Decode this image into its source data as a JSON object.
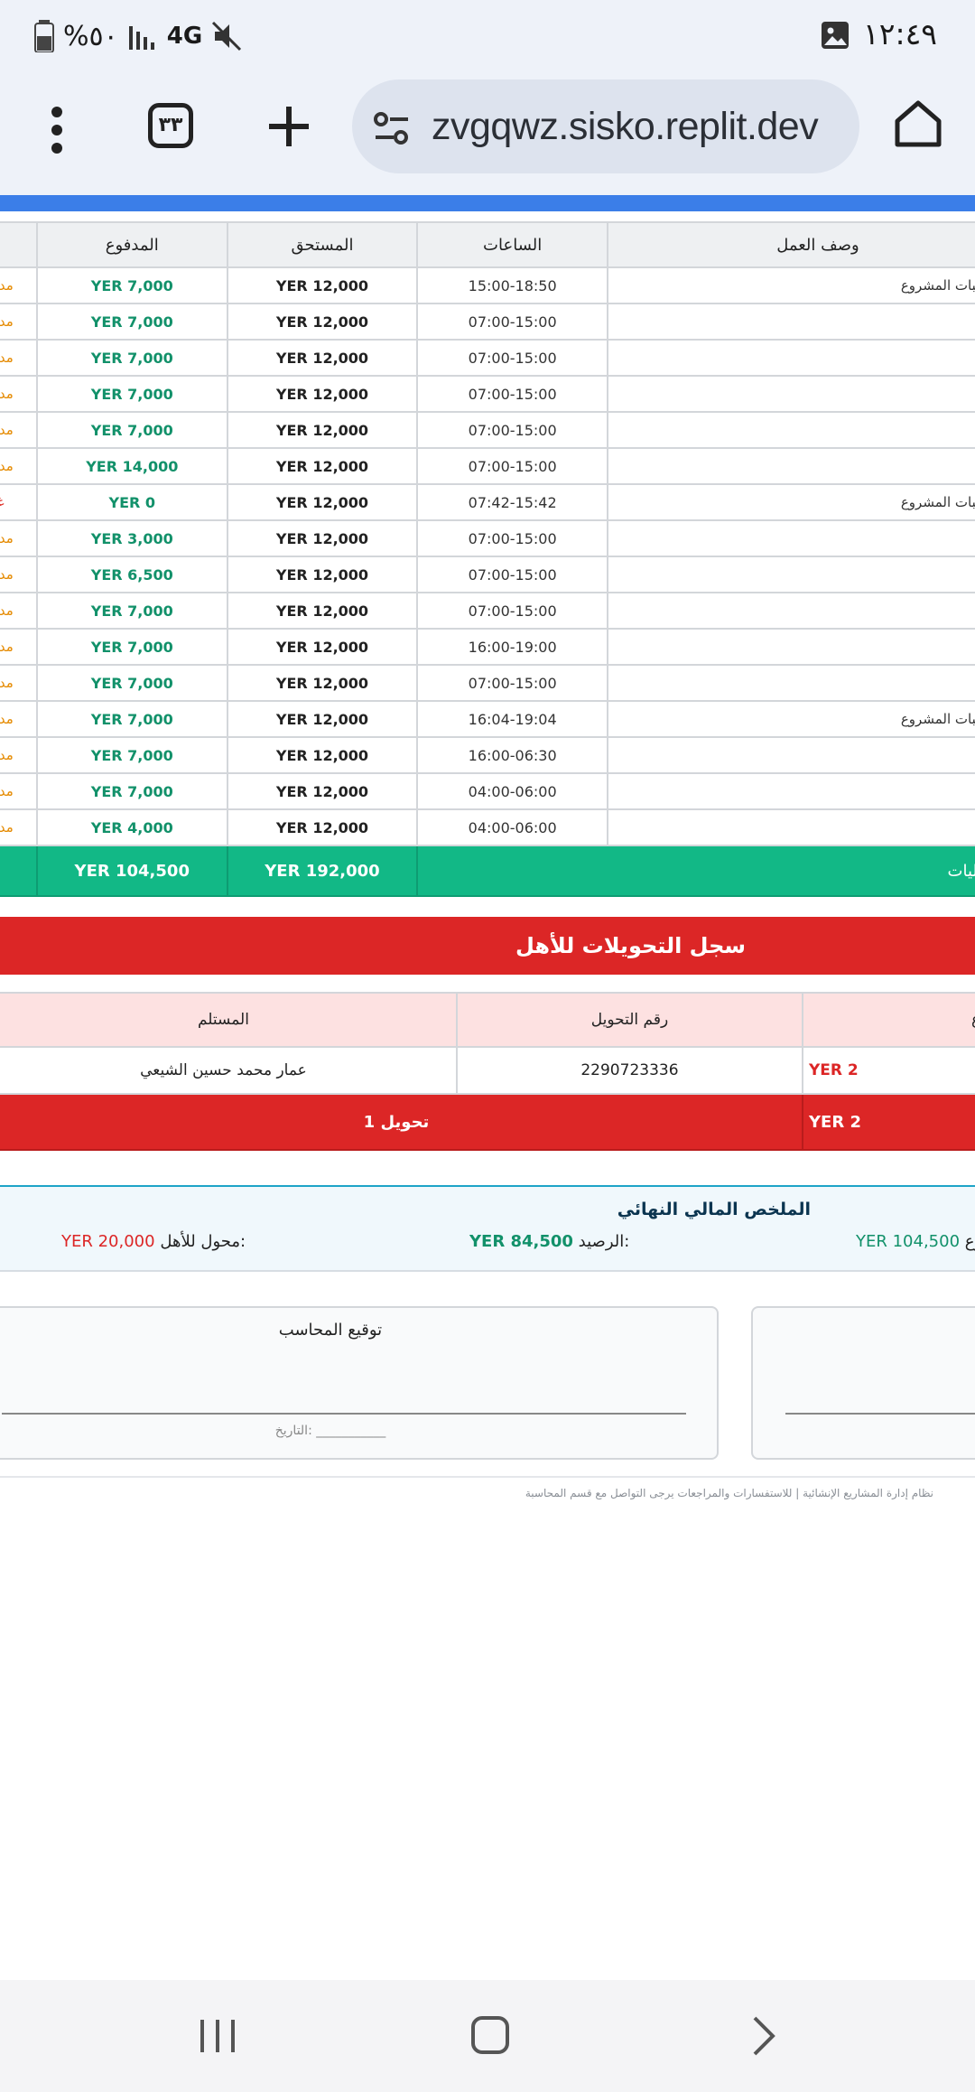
{
  "status_bar": {
    "time": "١٢:٤٩",
    "battery": "%٥٠",
    "network": "4G",
    "icons": [
      "gallery-icon",
      "mute-icon",
      "signal-icon",
      "battery-icon"
    ]
  },
  "browser": {
    "url": "zvgqwz.sisko.replit.dev",
    "tab_count": "٣٣",
    "icons": [
      "home-icon",
      "site-settings-icon",
      "new-tab-icon",
      "tab-switcher-icon",
      "menu-icon"
    ]
  },
  "work_table": {
    "headers": {
      "desc": "وصف العمل",
      "hours": "الساعات",
      "due": "المستحق",
      "paid": "المدفوع"
    },
    "rows": [
      {
        "desc": "طلبات المشروع",
        "hours": "15:00-18:50",
        "due": "YER 12,000",
        "paid": "YER 7,000",
        "status": "مدفو"
      },
      {
        "desc": "",
        "hours": "07:00-15:00",
        "due": "YER 12,000",
        "paid": "YER 7,000",
        "status": "مدفو"
      },
      {
        "desc": "",
        "hours": "07:00-15:00",
        "due": "YER 12,000",
        "paid": "YER 7,000",
        "status": "مدفو"
      },
      {
        "desc": "",
        "hours": "07:00-15:00",
        "due": "YER 12,000",
        "paid": "YER 7,000",
        "status": "مدفو"
      },
      {
        "desc": "",
        "hours": "07:00-15:00",
        "due": "YER 12,000",
        "paid": "YER 7,000",
        "status": "مدفو"
      },
      {
        "desc": "",
        "hours": "07:00-15:00",
        "due": "YER 12,000",
        "paid": "YER 14,000",
        "status": "مدفو"
      },
      {
        "desc": "طلبات المشروع",
        "hours": "07:42-15:42",
        "due": "YER 12,000",
        "paid": "YER 0",
        "status": "غير"
      },
      {
        "desc": "",
        "hours": "07:00-15:00",
        "due": "YER 12,000",
        "paid": "YER 3,000",
        "status": "مدفو"
      },
      {
        "desc": "",
        "hours": "07:00-15:00",
        "due": "YER 12,000",
        "paid": "YER 6,500",
        "status": "مدفو"
      },
      {
        "desc": "",
        "hours": "07:00-15:00",
        "due": "YER 12,000",
        "paid": "YER 7,000",
        "status": "مدفو"
      },
      {
        "desc": "",
        "hours": "16:00-19:00",
        "due": "YER 12,000",
        "paid": "YER 7,000",
        "status": "مدفو"
      },
      {
        "desc": "",
        "hours": "07:00-15:00",
        "due": "YER 12,000",
        "paid": "YER 7,000",
        "status": "مدفو"
      },
      {
        "desc": "طلبات المشروع",
        "hours": "16:04-19:04",
        "due": "YER 12,000",
        "paid": "YER 7,000",
        "status": "مدفو"
      },
      {
        "desc": "",
        "hours": "16:00-06:30",
        "due": "YER 12,000",
        "paid": "YER 7,000",
        "status": "مدفو"
      },
      {
        "desc": "",
        "hours": "04:00-06:00",
        "due": "YER 12,000",
        "paid": "YER 7,000",
        "status": "مدفو"
      },
      {
        "desc": "",
        "hours": "04:00-06:00",
        "due": "YER 12,000",
        "paid": "YER 4,000",
        "status": "مدفو"
      }
    ],
    "totals": {
      "label": "مالیات",
      "due": "YER 192,000",
      "paid": "YER 104,500",
      "status": "٪"
    }
  },
  "transfers": {
    "title": "سجل التحويلات للأهل",
    "headers": {
      "amount": "ع",
      "number": "رقم التحويل",
      "recipient": "المستلم"
    },
    "rows": [
      {
        "amount": "YER 2",
        "number": "2290723336",
        "recipient": "عمار محمد حسين الشيعي"
      }
    ],
    "footer": {
      "amount": "YER 2",
      "count": "1 تحويل"
    }
  },
  "summary": {
    "title": "الملخص المالي النهائي",
    "paid_label": "وع:",
    "paid_value": "YER 104,500",
    "balance_label": "الرصيد:",
    "balance_value": "YER 84,500",
    "transferred_label": "محول للأهل:",
    "transferred_value": "YER 20,000"
  },
  "signatures": {
    "accountant_title": "توقيع المحاسب",
    "date_label": "التاريخ: ___________"
  },
  "footer_note": "نظام إدارة المشاريع الإنشائية | للاستفسارات والمراجعات يرجى التواصل مع قسم المحاسبة"
}
